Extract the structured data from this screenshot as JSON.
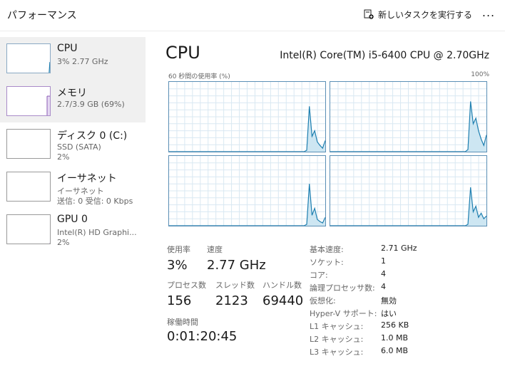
{
  "header": {
    "title": "パフォーマンス",
    "new_task_label": "新しいタスクを実行する",
    "more_label": "..."
  },
  "sidebar": {
    "items": [
      {
        "name": "CPU",
        "sub1": "3%  2.77 GHz",
        "sub2": ""
      },
      {
        "name": "メモリ",
        "sub1": "2.7/3.9 GB (69%)",
        "sub2": ""
      },
      {
        "name": "ディスク 0 (C:)",
        "sub1": "SSD (SATA)",
        "sub2": "2%"
      },
      {
        "name": "イーサネット",
        "sub1": "イーサネット",
        "sub2": "送信: 0 受信: 0 Kbps"
      },
      {
        "name": "GPU 0",
        "sub1": "Intel(R) HD Graphi...",
        "sub2": "2%"
      }
    ]
  },
  "main": {
    "title": "CPU",
    "model": "Intel(R) Core(TM) i5-6400 CPU @ 2.70GHz",
    "graph_caption": "60 秒間の使用率 (%)",
    "graph_max": "100%",
    "cores": [
      {
        "values": [
          0,
          0,
          0,
          0,
          0,
          0,
          0,
          0,
          0,
          0,
          0,
          0,
          0,
          0,
          0,
          0,
          0,
          0,
          0,
          0,
          0,
          0,
          0,
          0,
          0,
          0,
          0,
          0,
          0,
          0,
          0,
          0,
          0,
          0,
          0,
          0,
          0,
          0,
          0,
          0,
          0,
          0,
          0,
          0,
          0,
          0,
          0,
          0,
          0,
          0,
          0,
          0,
          2,
          65,
          22,
          30,
          14,
          9,
          5,
          16
        ]
      },
      {
        "values": [
          0,
          0,
          0,
          0,
          0,
          0,
          0,
          0,
          0,
          0,
          0,
          0,
          0,
          0,
          0,
          0,
          0,
          0,
          0,
          0,
          0,
          0,
          0,
          0,
          0,
          0,
          0,
          0,
          0,
          0,
          0,
          0,
          0,
          0,
          0,
          0,
          0,
          0,
          0,
          0,
          0,
          0,
          0,
          0,
          0,
          0,
          0,
          0,
          0,
          0,
          0,
          0,
          3,
          72,
          40,
          48,
          30,
          18,
          9,
          24
        ]
      },
      {
        "values": [
          0,
          0,
          0,
          0,
          0,
          0,
          0,
          0,
          0,
          0,
          0,
          0,
          0,
          0,
          0,
          0,
          0,
          0,
          0,
          0,
          0,
          0,
          0,
          0,
          0,
          0,
          0,
          0,
          0,
          0,
          0,
          0,
          0,
          0,
          0,
          0,
          0,
          0,
          0,
          0,
          0,
          0,
          0,
          0,
          0,
          0,
          0,
          0,
          0,
          0,
          0,
          0,
          2,
          60,
          15,
          25,
          9,
          6,
          4,
          12
        ]
      },
      {
        "values": [
          0,
          0,
          0,
          0,
          0,
          0,
          0,
          0,
          0,
          0,
          0,
          0,
          0,
          0,
          0,
          0,
          0,
          0,
          0,
          0,
          0,
          0,
          0,
          0,
          0,
          0,
          0,
          0,
          0,
          0,
          0,
          0,
          0,
          0,
          0,
          0,
          0,
          0,
          0,
          0,
          0,
          0,
          0,
          0,
          0,
          0,
          0,
          0,
          0,
          0,
          0,
          0,
          2,
          55,
          20,
          28,
          12,
          18,
          10,
          14
        ]
      }
    ],
    "thumbs": {
      "cpu": [
        0,
        0,
        0,
        0,
        0,
        0,
        0,
        0,
        0,
        0,
        0,
        0,
        0,
        0,
        0,
        0,
        0,
        0,
        0,
        0,
        0,
        0,
        0,
        0,
        0,
        0,
        0,
        0,
        0,
        0,
        0,
        0,
        0,
        0,
        0,
        0,
        0,
        0,
        0,
        0,
        0,
        0,
        0,
        0,
        0,
        0,
        0,
        0,
        0,
        0,
        0,
        0,
        0,
        0,
        0,
        0,
        2,
        40,
        12,
        8
      ],
      "memory_percent": 69,
      "disk": [
        0,
        0,
        0,
        0,
        0,
        0,
        0,
        0,
        0,
        0,
        0,
        0,
        0,
        0,
        0,
        0,
        0,
        0,
        0,
        0,
        0,
        0,
        0,
        0,
        0,
        0,
        0,
        0,
        0,
        0,
        0,
        0,
        0,
        0,
        0,
        0,
        0,
        0,
        0,
        0,
        0,
        0,
        0,
        0,
        0,
        0,
        0,
        0,
        0,
        0,
        0,
        0,
        0,
        0,
        0,
        0,
        0,
        0,
        0,
        0
      ],
      "ethernet": [
        0,
        0,
        0,
        0,
        0,
        0,
        0,
        0,
        0,
        0,
        0,
        0,
        0,
        0,
        0,
        0,
        0,
        0,
        0,
        0,
        0,
        0,
        0,
        0,
        0,
        0,
        0,
        0,
        0,
        0,
        0,
        0,
        0,
        0,
        0,
        0,
        0,
        0,
        0,
        0,
        0,
        0,
        0,
        0,
        0,
        0,
        0,
        0,
        0,
        0,
        0,
        0,
        0,
        0,
        0,
        0,
        0,
        0,
        0,
        0
      ],
      "gpu": [
        0,
        0,
        0,
        0,
        0,
        0,
        0,
        0,
        0,
        0,
        0,
        0,
        0,
        0,
        0,
        0,
        0,
        0,
        0,
        0,
        0,
        0,
        0,
        0,
        0,
        0,
        0,
        0,
        0,
        0,
        0,
        0,
        0,
        0,
        0,
        0,
        0,
        0,
        0,
        0,
        0,
        0,
        0,
        0,
        0,
        0,
        0,
        0,
        0,
        0,
        0,
        0,
        0,
        0,
        0,
        0,
        0,
        0,
        14,
        2
      ]
    },
    "stats": {
      "usage_label": "使用率",
      "usage_value": "3%",
      "speed_label": "速度",
      "speed_value": "2.77 GHz",
      "processes_label": "プロセス数",
      "processes_value": "156",
      "threads_label": "スレッド数",
      "threads_value": "2123",
      "handles_label": "ハンドル数",
      "handles_value": "69440",
      "uptime_label": "稼働時間",
      "uptime_value": "0:01:20:45"
    },
    "details": [
      {
        "key": "基本速度:",
        "value": "2.71 GHz"
      },
      {
        "key": "ソケット:",
        "value": "1"
      },
      {
        "key": "コア:",
        "value": "4"
      },
      {
        "key": "論理プロセッサ数:",
        "value": "4"
      },
      {
        "key": "仮想化:",
        "value": "無効"
      },
      {
        "key": "Hyper-V サポート:",
        "value": "はい"
      },
      {
        "key": "L1 キャッシュ:",
        "value": "256 KB"
      },
      {
        "key": "L2 キャッシュ:",
        "value": "1.0 MB"
      },
      {
        "key": "L3 キャッシュ:",
        "value": "6.0 MB"
      }
    ]
  },
  "colors": {
    "cpu_line": "#1e7fb0",
    "cpu_fill": "#cde6f2",
    "memory_line": "#8b5bb5",
    "memory_fill": "#e5d9f2",
    "disk_line": "#4f8a10",
    "gpu_line": "#8b5bb5",
    "grid": "#d9e8f2"
  }
}
